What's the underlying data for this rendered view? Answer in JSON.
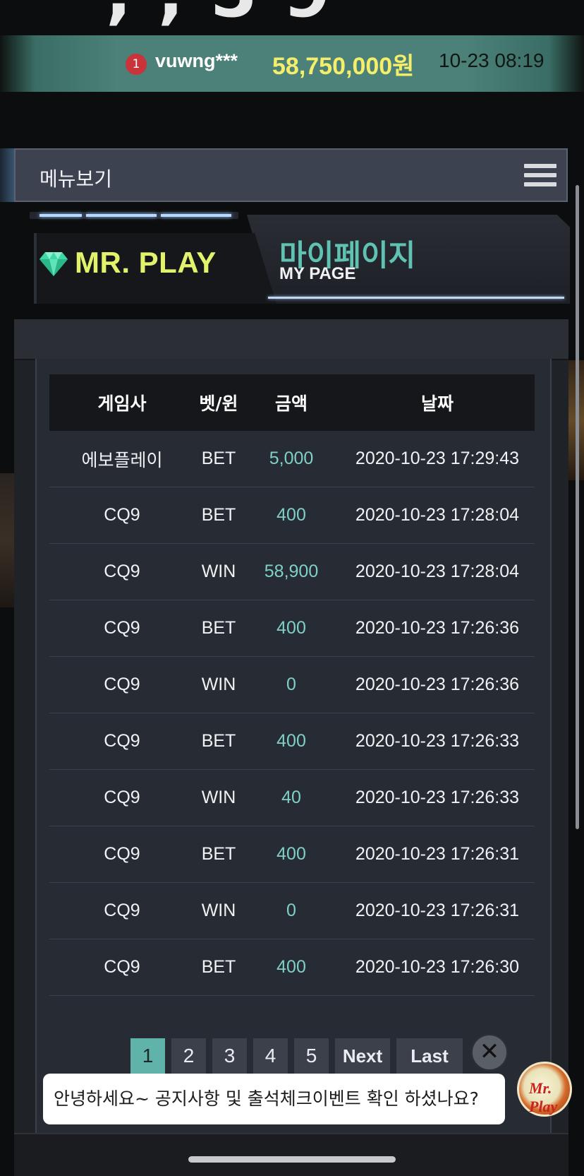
{
  "ticker": {
    "rank": "1",
    "user": "vuwng***",
    "amount": "58,750,000원",
    "datetime": "10-23 08:19"
  },
  "menu": {
    "label": "메뉴보기",
    "icon": "hamburger-menu-icon"
  },
  "header": {
    "brand": "MR. PLAY",
    "brand_icon": "diamond-gem-icon",
    "title_ko": "마이페이지",
    "title_en": "MY PAGE"
  },
  "table": {
    "columns": [
      "게임사",
      "벳/윈",
      "금액",
      "날짜"
    ],
    "rows": [
      {
        "provider": "에보플레이",
        "type": "BET",
        "amount": "5,000",
        "date": "2020-10-23 17:29:43"
      },
      {
        "provider": "CQ9",
        "type": "BET",
        "amount": "400",
        "date": "2020-10-23 17:28:04"
      },
      {
        "provider": "CQ9",
        "type": "WIN",
        "amount": "58,900",
        "date": "2020-10-23 17:28:04"
      },
      {
        "provider": "CQ9",
        "type": "BET",
        "amount": "400",
        "date": "2020-10-23 17:26:36"
      },
      {
        "provider": "CQ9",
        "type": "WIN",
        "amount": "0",
        "date": "2020-10-23 17:26:36"
      },
      {
        "provider": "CQ9",
        "type": "BET",
        "amount": "400",
        "date": "2020-10-23 17:26:33"
      },
      {
        "provider": "CQ9",
        "type": "WIN",
        "amount": "40",
        "date": "2020-10-23 17:26:33"
      },
      {
        "provider": "CQ9",
        "type": "BET",
        "amount": "400",
        "date": "2020-10-23 17:26:31"
      },
      {
        "provider": "CQ9",
        "type": "WIN",
        "amount": "0",
        "date": "2020-10-23 17:26:31"
      },
      {
        "provider": "CQ9",
        "type": "BET",
        "amount": "400",
        "date": "2020-10-23 17:26:30"
      }
    ]
  },
  "pagination": {
    "pages": [
      "1",
      "2",
      "3",
      "4",
      "5"
    ],
    "active": "1",
    "next": "Next",
    "last": "Last"
  },
  "chat": {
    "message": "안녕하세요~ 공지사항 및 출석체크이벤트 확인 하셨나요?",
    "close_icon": "close-icon",
    "avatar_text": "Mr. Play"
  },
  "colors": {
    "accent_teal": "#5fc2b3",
    "brand_yellow": "#e2f26a",
    "amount_yellow": "#f5ee6a",
    "amount_value": "#7fd0c6"
  }
}
